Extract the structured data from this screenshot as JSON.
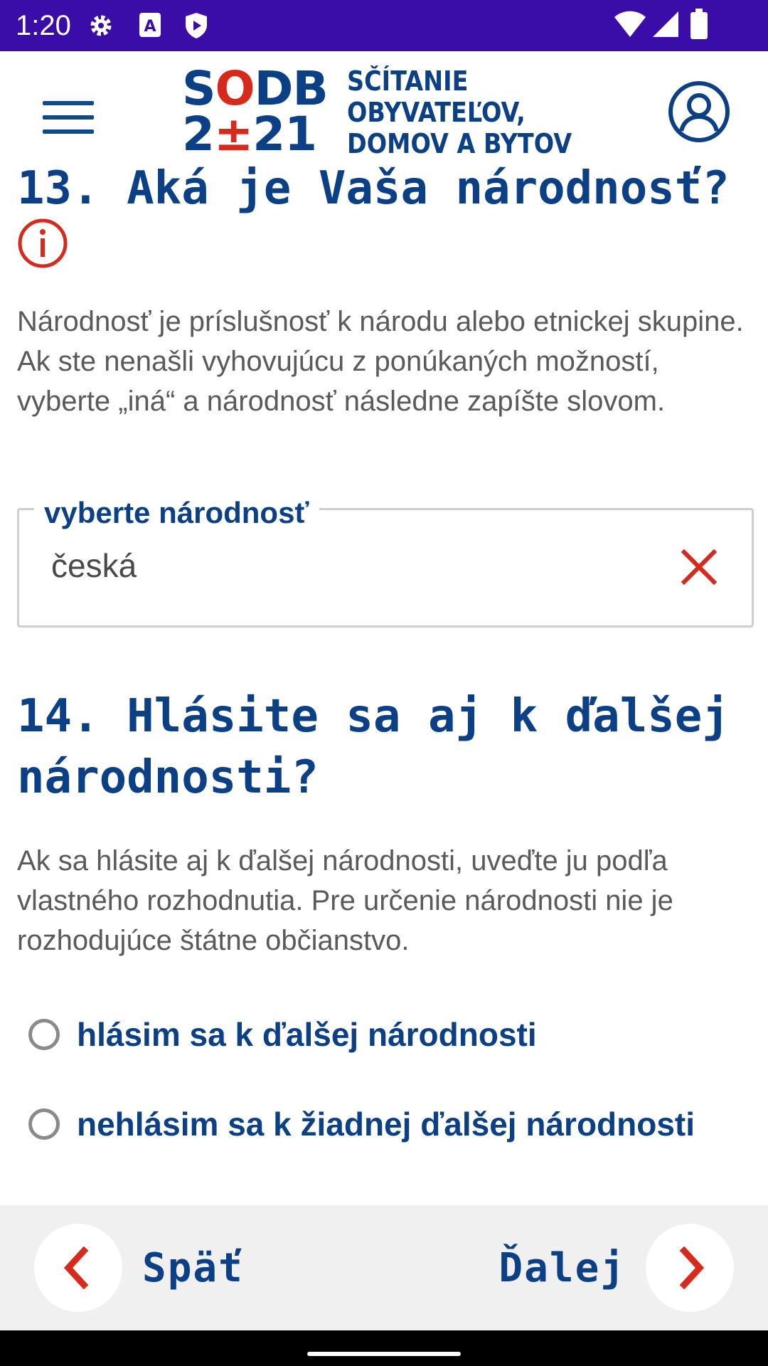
{
  "status_bar": {
    "time": "1:20",
    "icons": [
      "gear-icon",
      "a-text-icon",
      "shield-play-icon",
      "wifi-icon",
      "signal-icon",
      "battery-icon"
    ]
  },
  "header": {
    "logo_line1_a": "S",
    "logo_line1_red": "O",
    "logo_line1_b": "DB",
    "logo_line2_a": "2",
    "logo_line2_red": "±",
    "logo_line2_b": "21",
    "logo_text_1": "SČÍTANIE",
    "logo_text_2": "OBYVATEĽOV,",
    "logo_text_3": "DOMOV A BYTOV",
    "menu_icon": "hamburger-menu-icon",
    "profile_icon": "user-profile-icon"
  },
  "question13": {
    "title": "13. Aká je Vaša národnosť?",
    "info_icon": "info-icon",
    "description": "Národnosť je príslušnosť k národu alebo etnickej skupine. Ak ste nenašli vyhovujúcu z ponúkaných možností, vyberte „iná“ a národnosť následne zapíšte slovom.",
    "field_label": "vyberte národnosť",
    "field_value": "česká",
    "clear_icon": "close-icon"
  },
  "question14": {
    "title": "14. Hlásite sa aj k ďalšej národnosti?",
    "description": "Ak sa hlásite aj k ďalšej národnosti, uveďte ju podľa vlastného rozhodnutia. Pre určenie národnosti nie je rozhodujúce štátne občianstvo.",
    "options": [
      {
        "label": "hlásim sa k ďalšej národnosti",
        "selected": false
      },
      {
        "label": "nehlásim sa k žiadnej ďalšej národnosti",
        "selected": false
      }
    ]
  },
  "navigation": {
    "back_label": "Späť",
    "next_label": "Ďalej"
  },
  "colors": {
    "status_bar": "#3a0ca8",
    "primary_blue": "#0b3f86",
    "accent_red": "#d72a1d",
    "nav_background": "#f0f0f0"
  }
}
